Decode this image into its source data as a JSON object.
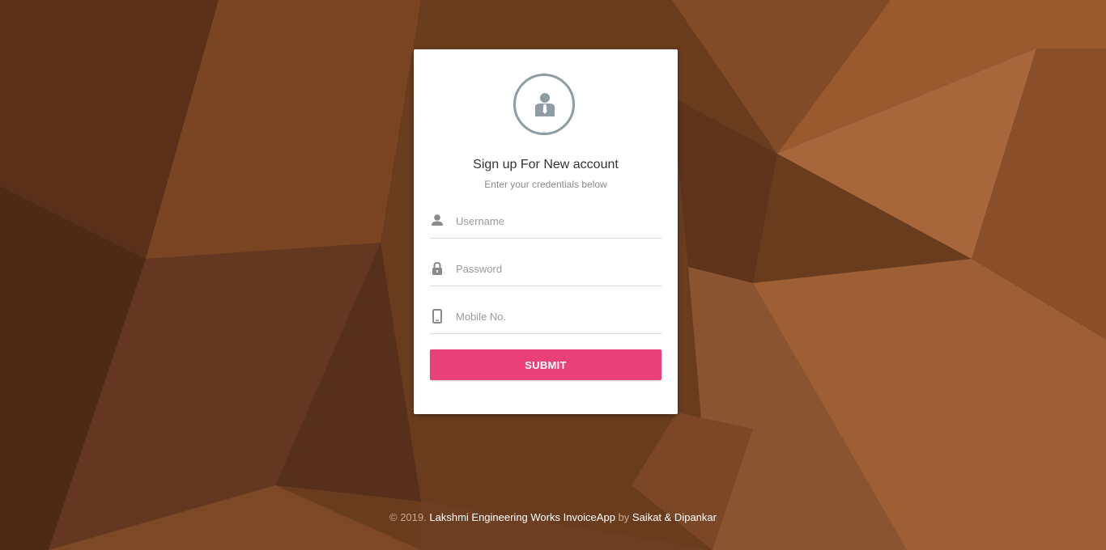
{
  "form": {
    "title": "Sign up For New account",
    "subtitle": "Enter your credentials below",
    "username_placeholder": "Username",
    "password_placeholder": "Password",
    "mobile_placeholder": "Mobile No.",
    "submit_label": "SUBMIT"
  },
  "footer": {
    "copyright": "© 2019.",
    "app_name": "Lakshmi Engineering Works InvoiceApp",
    "by": "by",
    "authors": "Saikat & Dipankar"
  },
  "icons": {
    "avatar": "user-tie-icon",
    "username": "person-icon",
    "password": "lock-icon",
    "mobile": "mobile-phone-icon"
  },
  "colors": {
    "accent": "#e9407a",
    "icon_gray": "#8e9ca3",
    "background": "#6b3d1f"
  }
}
